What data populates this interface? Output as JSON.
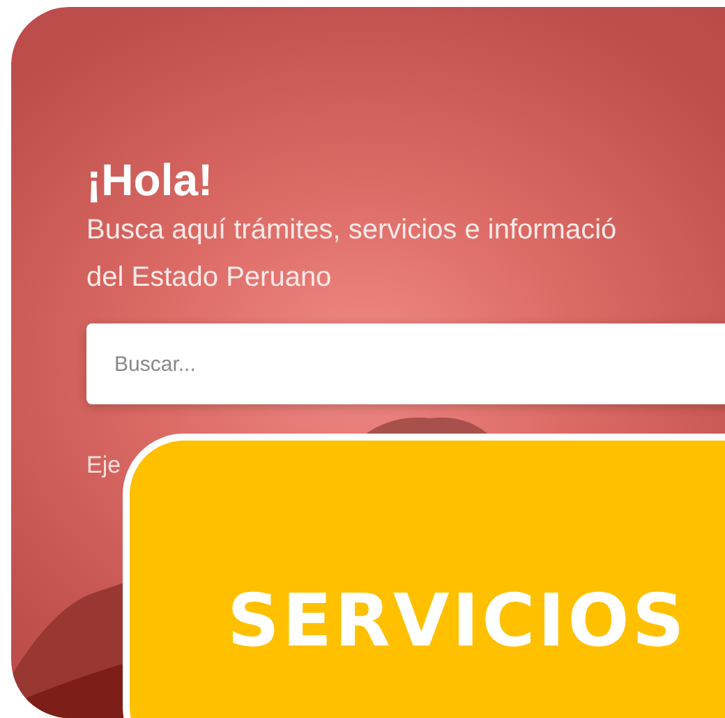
{
  "hero": {
    "greeting": "¡Hola!",
    "subtitle_lines": [
      "Busca aquí trámites, servicios e informació",
      "del Estado Peruano"
    ],
    "search": {
      "placeholder": "Buscar..."
    },
    "examples_label": "Eje"
  },
  "card": {
    "title": "SERVICIOS"
  }
}
